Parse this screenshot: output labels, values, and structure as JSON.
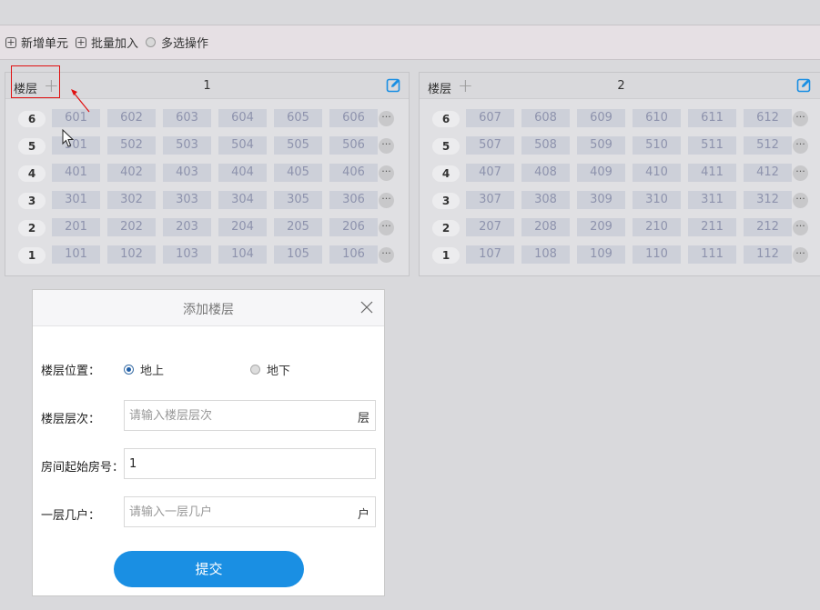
{
  "toolbar": {
    "add_unit": "新增单元",
    "batch_add": "批量加入",
    "multi_select": "多选操作"
  },
  "units": [
    {
      "floor_label": "楼层",
      "title": "1",
      "floors": [
        {
          "num": "6",
          "rooms": [
            "601",
            "602",
            "603",
            "604",
            "605",
            "606"
          ]
        },
        {
          "num": "5",
          "rooms": [
            "501",
            "502",
            "503",
            "504",
            "505",
            "506"
          ]
        },
        {
          "num": "4",
          "rooms": [
            "401",
            "402",
            "403",
            "404",
            "405",
            "406"
          ]
        },
        {
          "num": "3",
          "rooms": [
            "301",
            "302",
            "303",
            "304",
            "305",
            "306"
          ]
        },
        {
          "num": "2",
          "rooms": [
            "201",
            "202",
            "203",
            "204",
            "205",
            "206"
          ]
        },
        {
          "num": "1",
          "rooms": [
            "101",
            "102",
            "103",
            "104",
            "105",
            "106"
          ]
        }
      ]
    },
    {
      "floor_label": "楼层",
      "title": "2",
      "floors": [
        {
          "num": "6",
          "rooms": [
            "607",
            "608",
            "609",
            "610",
            "611",
            "612"
          ]
        },
        {
          "num": "5",
          "rooms": [
            "507",
            "508",
            "509",
            "510",
            "511",
            "512"
          ]
        },
        {
          "num": "4",
          "rooms": [
            "407",
            "408",
            "409",
            "410",
            "411",
            "412"
          ]
        },
        {
          "num": "3",
          "rooms": [
            "307",
            "308",
            "309",
            "310",
            "311",
            "312"
          ]
        },
        {
          "num": "2",
          "rooms": [
            "207",
            "208",
            "209",
            "210",
            "211",
            "212"
          ]
        },
        {
          "num": "1",
          "rooms": [
            "107",
            "108",
            "109",
            "110",
            "111",
            "112"
          ]
        }
      ]
    }
  ],
  "more_glyph": "···",
  "dialog": {
    "title": "添加楼层",
    "position_label": "楼层位置：",
    "position_above": "地上",
    "position_below": "地下",
    "floor_count_label": "楼层层次：",
    "floor_count_placeholder": "请输入楼层层次",
    "floor_count_suffix": "层",
    "start_room_label": "房间起始房号：",
    "start_room_value": "1",
    "per_floor_label": "一层几户：",
    "per_floor_placeholder": "请输入一层几户",
    "per_floor_suffix": "户",
    "submit_label": "提交"
  },
  "colors": {
    "accent": "#1a8fe3",
    "highlight": "#e01010",
    "room_bg": "#cdd0d9",
    "room_text": "#8e93ad"
  }
}
